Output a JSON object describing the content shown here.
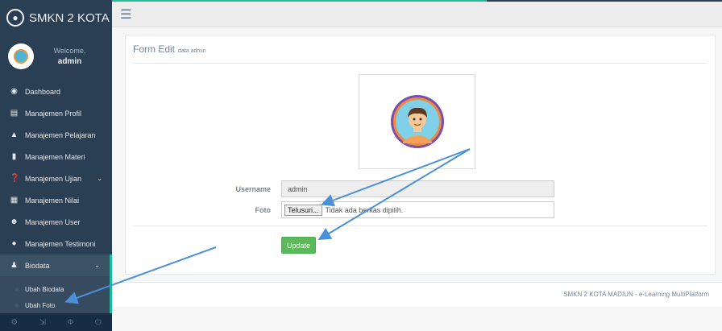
{
  "brand": {
    "name": "SMKN 2 KOTA",
    "icon": "paw-icon"
  },
  "profile": {
    "welcome": "Welcome,",
    "username": "admin"
  },
  "menu": [
    {
      "label": "Dashboard",
      "icon": "dashboard-icon"
    },
    {
      "label": "Manajemen Profil",
      "icon": "bank-icon"
    },
    {
      "label": "Manajemen Pelajaran",
      "icon": "graduation-cap-icon"
    },
    {
      "label": "Manajemen Materi",
      "icon": "file-icon"
    },
    {
      "label": "Manajemen Ujian",
      "icon": "question-icon"
    },
    {
      "label": "Manajemen Nilai",
      "icon": "table-icon"
    },
    {
      "label": "Manajemen User",
      "icon": "users-icon"
    },
    {
      "label": "Manajemen Testimoni",
      "icon": "comments-icon"
    },
    {
      "label": "Biodata",
      "icon": "user-icon"
    }
  ],
  "submenu": [
    {
      "label": "Ubah Biodata"
    },
    {
      "label": "Ubah Foto"
    }
  ],
  "form": {
    "title": "Form Edit",
    "subtitle": "data admin",
    "username_label": "Username",
    "username_value": "admin",
    "foto_label": "Foto",
    "file_button": "Telusuri...",
    "file_status": "Tidak ada berkas dipilih.",
    "update_label": "Update"
  },
  "footer": {
    "text": "SMKN 2 KOTA MADIUN - e-Learning MultiPlatform"
  },
  "colors": {
    "sidebar": "#2a3f54",
    "accent": "#1abb9c",
    "update": "#5cb85c",
    "annotation": "#4a90d9"
  }
}
